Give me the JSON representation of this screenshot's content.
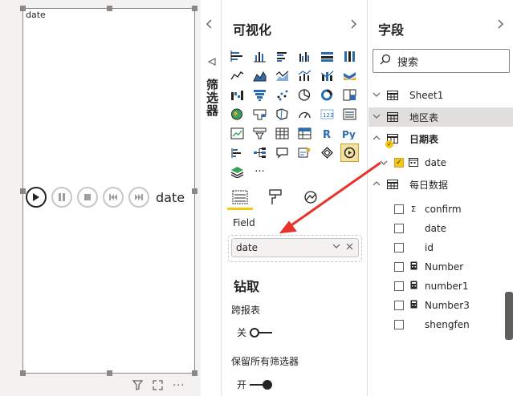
{
  "visual": {
    "label": "date",
    "field_text": "date",
    "play_icon": "play-icon",
    "pause_icon": "pause-icon",
    "stop_icon": "stop-icon",
    "prev_icon": "skip-back-icon",
    "next_icon": "skip-forward-icon"
  },
  "filters_pane": {
    "title": "筛选器"
  },
  "viz_pane": {
    "title": "可视化",
    "more_label": "···",
    "field_label": "Field",
    "field_value": "date",
    "drill_title": "钻取",
    "cross_report_label": "跨报表",
    "cross_report_state": "关",
    "keep_filters_label": "保留所有筛选器",
    "keep_filters_state": "开"
  },
  "fields_pane": {
    "title": "字段",
    "search_placeholder": "搜索",
    "tables": [
      {
        "name": "Sheet1",
        "expanded": false,
        "highlight": false
      },
      {
        "name": "地区表",
        "expanded": false,
        "highlight": true
      },
      {
        "name": "日期表",
        "expanded": true,
        "highlight": false,
        "fields": [
          {
            "name": "date",
            "checked": true,
            "type": "calendar"
          }
        ]
      },
      {
        "name": "每日数据",
        "expanded": true,
        "highlight": false,
        "fields": [
          {
            "name": "confirm",
            "type": "sigma"
          },
          {
            "name": "date",
            "type": "none"
          },
          {
            "name": "id",
            "type": "none"
          },
          {
            "name": "Number",
            "type": "calc"
          },
          {
            "name": "number1",
            "type": "calc"
          },
          {
            "name": "Number3",
            "type": "calc"
          },
          {
            "name": "shengfen",
            "type": "none"
          }
        ]
      }
    ]
  },
  "colors": {
    "accent": "#f2c811",
    "arrow": "#e8322b",
    "border": "#8a8886"
  }
}
